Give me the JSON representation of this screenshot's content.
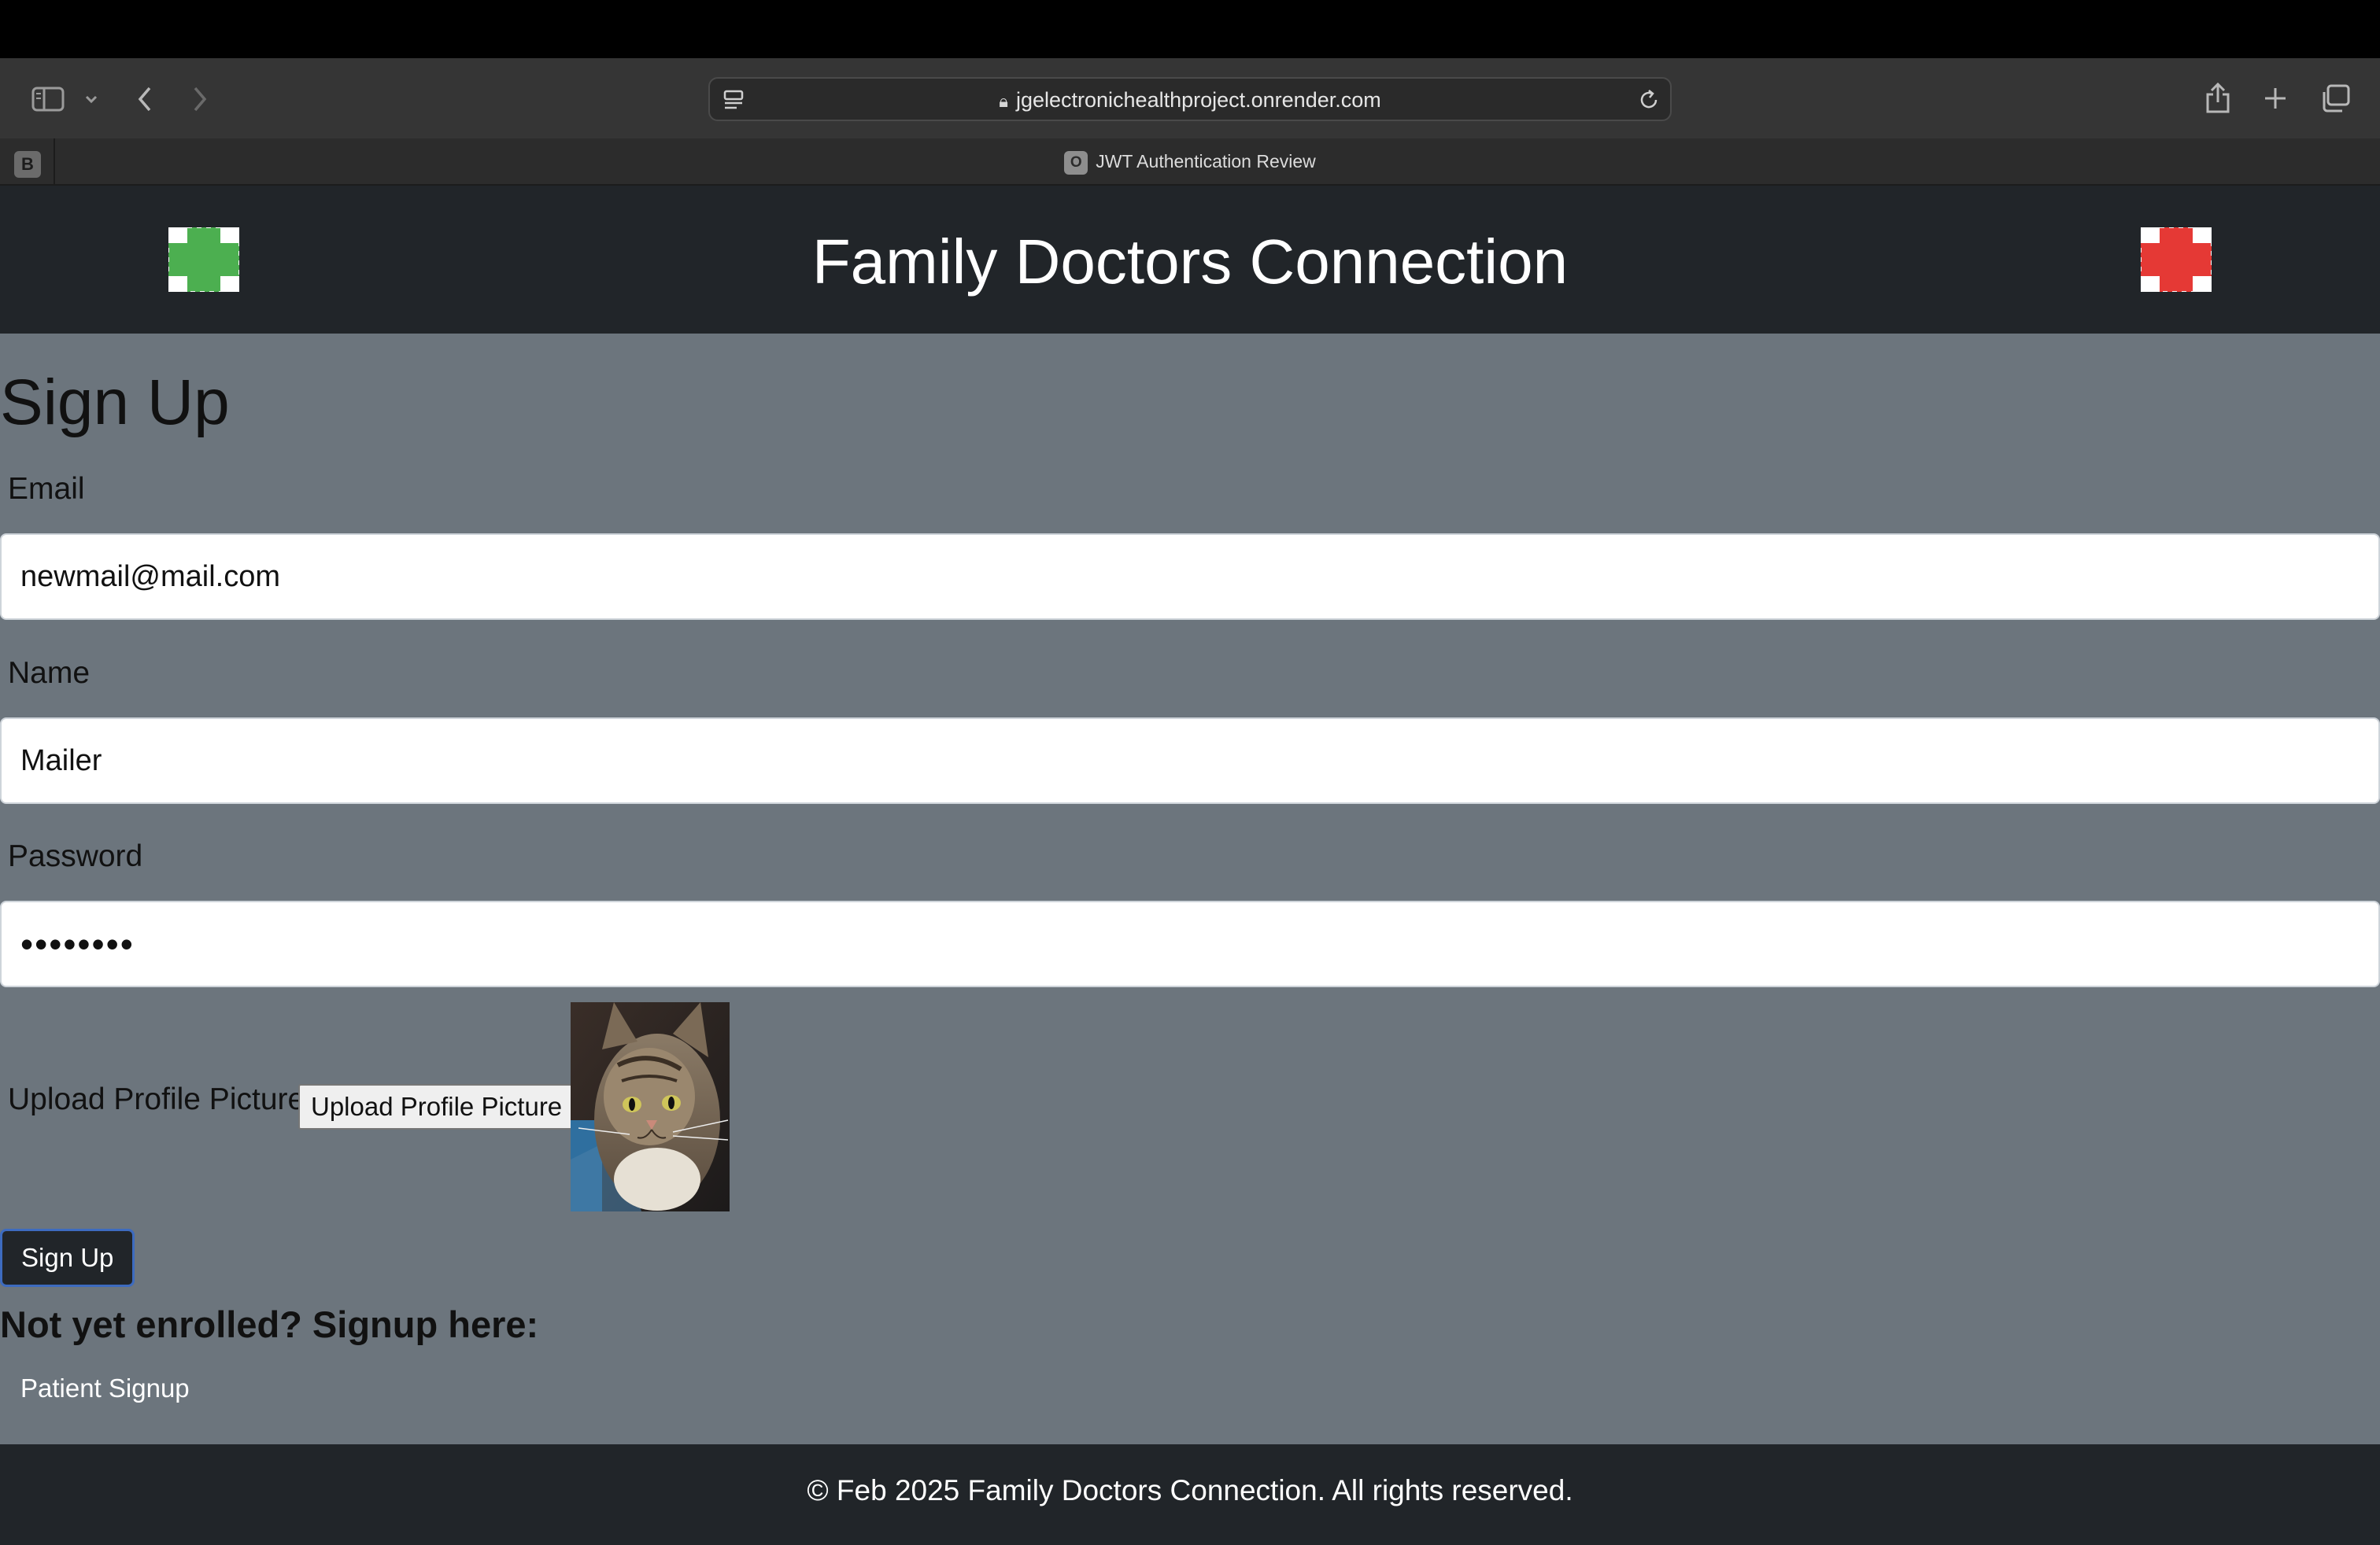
{
  "browser": {
    "url": "jgelectronichealthproject.onrender.com",
    "tab_title": "JWT Authentication Review",
    "tab_favicon_letter": "O",
    "left_tab_badge": "B"
  },
  "header": {
    "title": "Family Doctors Connection",
    "left_logo_color": "#4caf50",
    "right_logo_color": "#e53935"
  },
  "form": {
    "heading": "Sign Up",
    "email": {
      "label": "Email",
      "value": "newmail@mail.com"
    },
    "name": {
      "label": "Name",
      "value": "Mailer"
    },
    "password": {
      "label": "Password",
      "value": "••••••••"
    },
    "upload": {
      "label": "Upload Profile Picture",
      "button_label": "Upload Profile Picture",
      "preview": "cat-photo"
    },
    "submit_label": "Sign Up"
  },
  "enroll": {
    "heading": "Not yet enrolled? Signup here:",
    "link_label": "Patient Signup"
  },
  "footer": {
    "text": "© Feb 2025 Family Doctors Connection. All rights reserved."
  },
  "colors": {
    "page_bg": "#6c757d",
    "header_bg": "#212529",
    "button_border": "#3d6bbf"
  }
}
